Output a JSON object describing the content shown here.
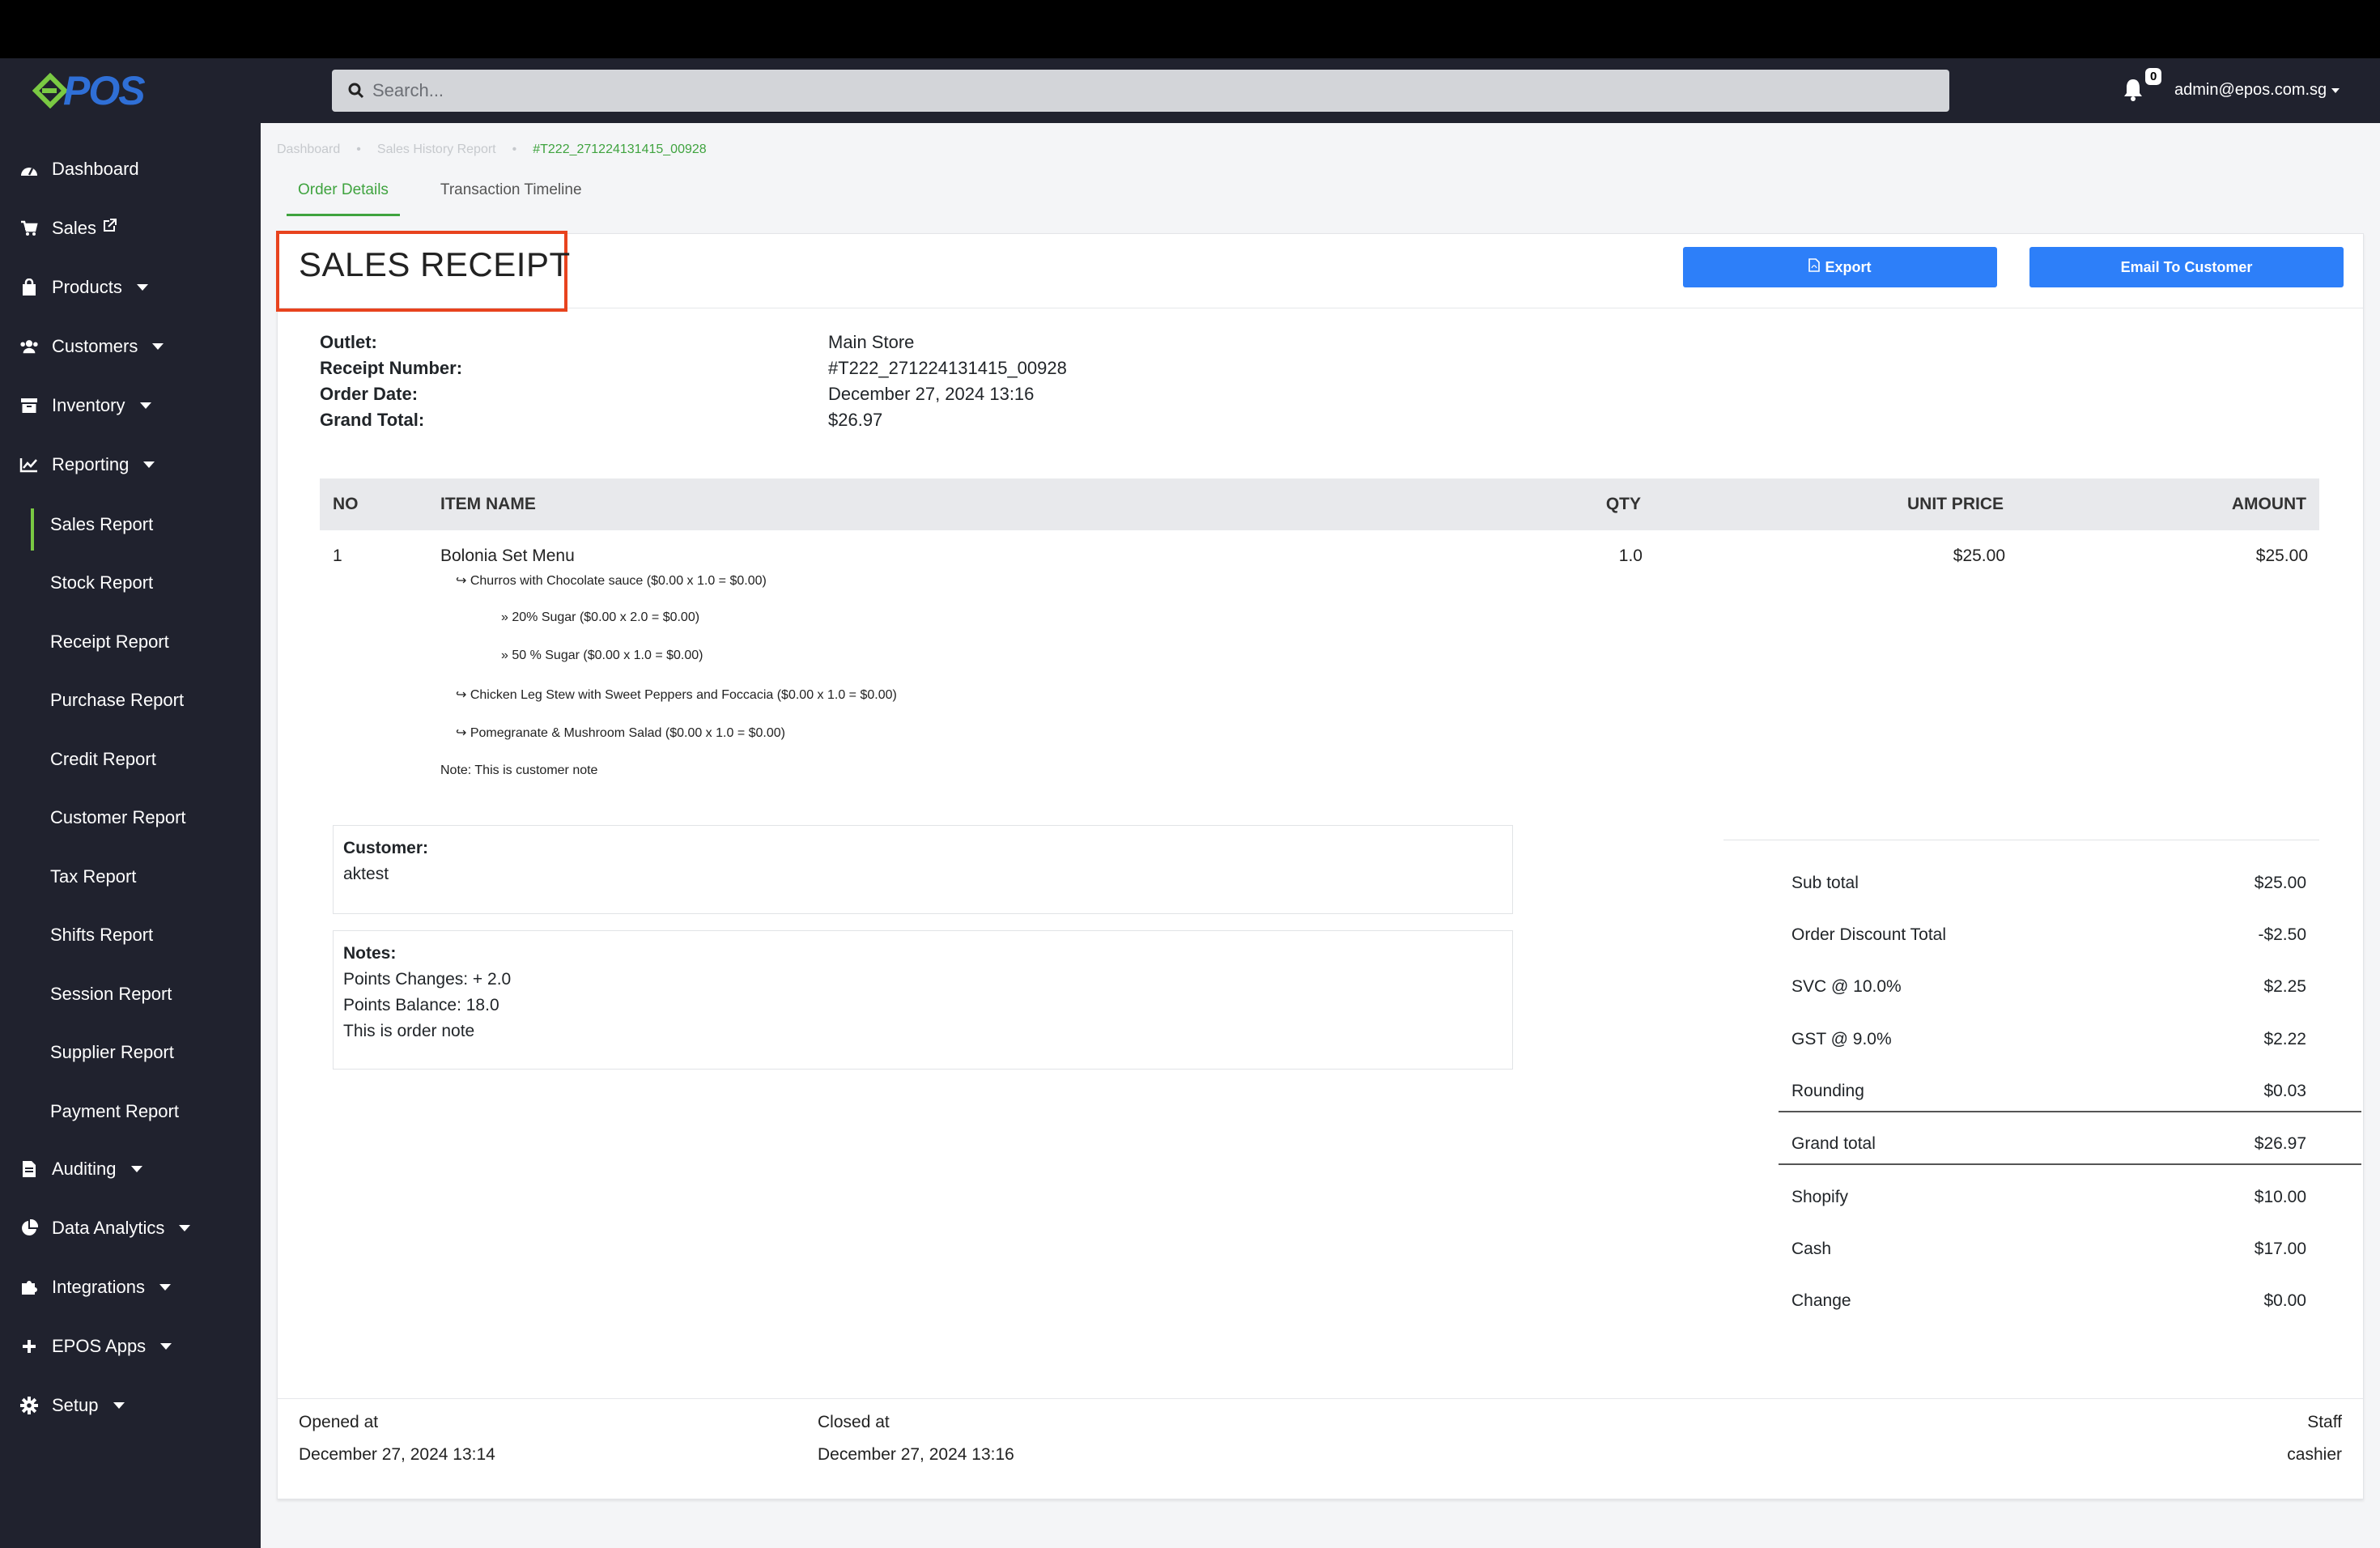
{
  "app": {
    "logo_text": "POS",
    "search_placeholder": "Search...",
    "notification_count": "0",
    "user_email": "admin@epos.com.sg"
  },
  "sidebar": {
    "items": [
      {
        "label": "Dashboard",
        "icon": "dashboard-icon"
      },
      {
        "label": "Sales",
        "icon": "cart-icon"
      },
      {
        "label": "Products",
        "icon": "bag-icon"
      },
      {
        "label": "Customers",
        "icon": "users-icon"
      },
      {
        "label": "Inventory",
        "icon": "archive-icon"
      },
      {
        "label": "Reporting",
        "icon": "chart-icon"
      }
    ],
    "reporting_sub": [
      "Sales Report",
      "Stock Report",
      "Receipt Report",
      "Purchase Report",
      "Credit Report",
      "Customer Report",
      "Tax Report",
      "Shifts Report",
      "Session Report",
      "Supplier Report",
      "Payment Report"
    ],
    "items_after": [
      {
        "label": "Auditing",
        "icon": "file-icon"
      },
      {
        "label": "Data Analytics",
        "icon": "pie-icon"
      },
      {
        "label": "Integrations",
        "icon": "puzzle-icon"
      },
      {
        "label": "EPOS Apps",
        "icon": "plus-icon"
      },
      {
        "label": "Setup",
        "icon": "gear-icon"
      }
    ]
  },
  "breadcrumb": [
    "Dashboard",
    "Sales History Report",
    "#T222_271224131415_00928"
  ],
  "tabs": [
    "Order Details",
    "Transaction Timeline"
  ],
  "receipt": {
    "title": "SALES RECEIPT",
    "export_label": "Export",
    "email_label": "Email To Customer",
    "info": [
      {
        "label": "Outlet:",
        "value": "Main Store"
      },
      {
        "label": "Receipt Number:",
        "value": "#T222_271224131415_00928"
      },
      {
        "label": "Order Date:",
        "value": "December 27, 2024 13:16"
      },
      {
        "label": "Grand Total:",
        "value": "$26.97"
      }
    ],
    "columns": [
      "NO",
      "ITEM NAME",
      "QTY",
      "UNIT PRICE",
      "AMOUNT"
    ],
    "item": {
      "no": "1",
      "name": "Bolonia Set Menu",
      "qty": "1.0",
      "unit_price": "$25.00",
      "amount": "$25.00",
      "modifiers": [
        "↪ Churros with Chocolate sauce ($0.00 x 1.0 = $0.00)",
        "» 20% Sugar ($0.00 x 2.0 = $0.00)",
        "» 50 % Sugar ($0.00 x 1.0 = $0.00)",
        "↪ Chicken Leg Stew with Sweet Peppers and Foccacia ($0.00 x 1.0 = $0.00)",
        "↪ Pomegranate & Mushroom Salad ($0.00 x 1.0 = $0.00)"
      ],
      "note": "Note: This is customer note"
    },
    "customer_label": "Customer:",
    "customer_value": "aktest",
    "notes_label": "Notes:",
    "notes_lines": [
      "Points Changes: + 2.0",
      "Points Balance: 18.0",
      "This is order note"
    ],
    "totals": [
      {
        "label": "Sub total",
        "value": "$25.00"
      },
      {
        "label": "Order Discount Total",
        "value": "-$2.50"
      },
      {
        "label": "SVC @ 10.0%",
        "value": "$2.25"
      },
      {
        "label": "GST @ 9.0%",
        "value": "$2.22"
      },
      {
        "label": "Rounding",
        "value": "$0.03"
      },
      {
        "label": "Grand total",
        "value": "$26.97"
      },
      {
        "label": "Shopify",
        "value": "$10.00"
      },
      {
        "label": "Cash",
        "value": "$17.00"
      },
      {
        "label": "Change",
        "value": "$0.00"
      }
    ],
    "footer": {
      "opened_label": "Opened at",
      "opened_value": "December 27, 2024 13:14",
      "closed_label": "Closed at",
      "closed_value": "December 27, 2024 13:16",
      "staff_label": "Staff",
      "staff_value": "cashier"
    }
  },
  "colors": {
    "accent": "#2d7ff9",
    "active": "#3fa33f",
    "sidebar": "#20222e",
    "highlight": "#e8431e"
  }
}
